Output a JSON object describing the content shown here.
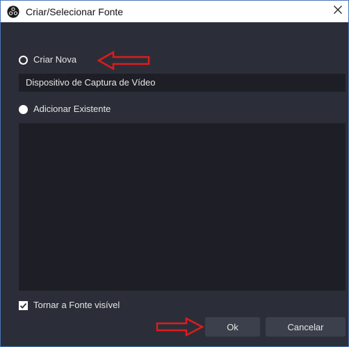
{
  "window": {
    "title": "Criar/Selecionar Fonte",
    "app_icon": "obs-logo-icon",
    "close_icon": "close-icon"
  },
  "options": {
    "create_new_label": "Criar Nova",
    "create_new_selected": false,
    "source_name_value": "Dispositivo de Captura de Vídeo",
    "add_existing_label": "Adicionar Existente",
    "add_existing_selected": true,
    "existing_sources": []
  },
  "visibility": {
    "checkbox_label": "Tornar a Fonte visível",
    "checked": true
  },
  "buttons": {
    "ok_label": "Ok",
    "cancel_label": "Cancelar"
  },
  "annotations": {
    "arrow_color": "#e01b1b",
    "arrow_icon": "red-arrow-icon"
  },
  "colors": {
    "background": "#2b2e38",
    "field_background": "#1e1f26",
    "button_background": "#3c404d",
    "title_bar": "#ffffff",
    "window_border": "#4a76b7"
  }
}
